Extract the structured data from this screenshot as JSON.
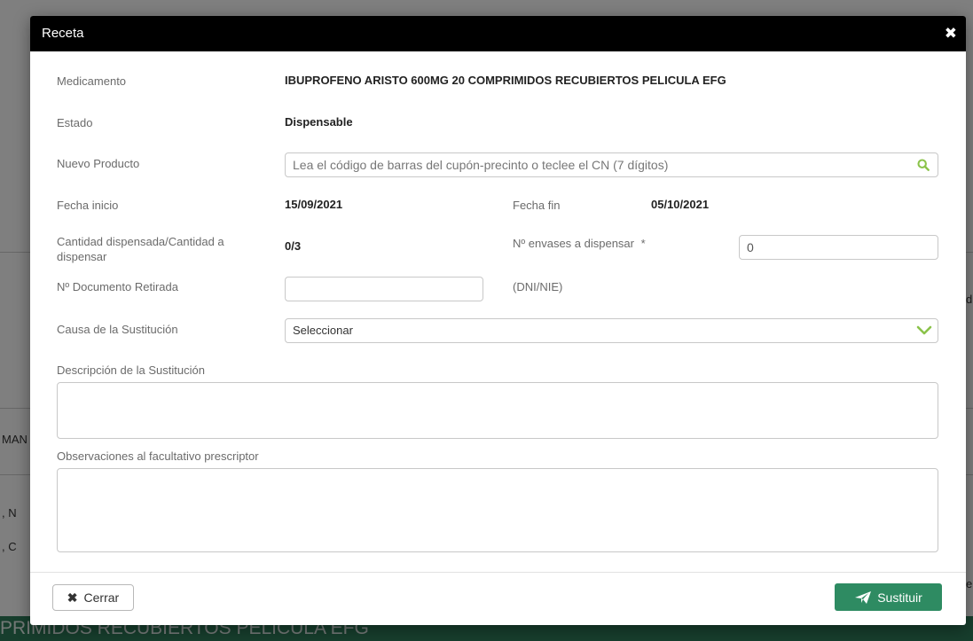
{
  "background": {
    "partial_texts": [
      "MAN",
      ", N",
      ", C",
      "e",
      "d"
    ],
    "bottom_bar_text": "PRIMIDOS RECUBIERTOS PELICULA EFG"
  },
  "modal": {
    "title": "Receta",
    "close_icon": "close-icon",
    "fields": {
      "medicamento_label": "Medicamento",
      "medicamento_value": "IBUPROFENO ARISTO 600MG 20 COMPRIMIDOS RECUBIERTOS PELICULA EFG",
      "estado_label": "Estado",
      "estado_value": "Dispensable",
      "nuevo_producto_label": "Nuevo Producto",
      "nuevo_producto_placeholder": "Lea el código de barras del cupón-precinto o teclee el CN (7 dígitos)",
      "fecha_inicio_label": "Fecha inicio",
      "fecha_inicio_value": "15/09/2021",
      "fecha_fin_label": "Fecha fin",
      "fecha_fin_value": "05/10/2021",
      "cantidad_label": "Cantidad dispensada/Cantidad a dispensar",
      "cantidad_value": "0/3",
      "envases_label": "Nº envases a dispensar",
      "envases_required": "*",
      "envases_value": "0",
      "documento_label": "Nº Documento Retirada",
      "documento_value": "",
      "documento_hint": "(DNI/NIE)",
      "causa_label": "Causa de la Sustitución",
      "causa_selected": "Seleccionar",
      "descripcion_label": "Descripción de la Sustitución",
      "observaciones_label": "Observaciones al facultativo prescriptor"
    },
    "footer": {
      "cerrar_label": "Cerrar",
      "sustituir_label": "Sustituir"
    }
  },
  "colors": {
    "accent": "#2e8b62",
    "icon_green": "#8bc34a",
    "header_bg": "#000000"
  }
}
